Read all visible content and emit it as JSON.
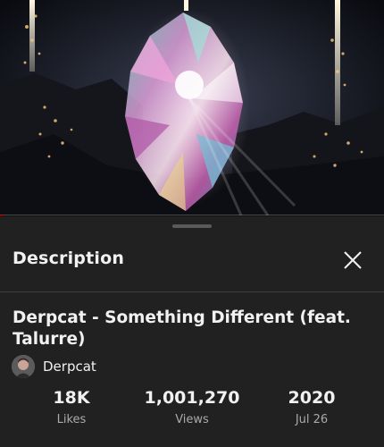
{
  "player": {
    "progress": 0.01,
    "accent_color": "#ff0000"
  },
  "description_panel": {
    "heading": "Description",
    "close_icon": "close-icon",
    "video_title": "Derpcat - Something Different (feat. Talurre)",
    "channel": {
      "name": "Derpcat",
      "avatar_icon": "channel-avatar"
    },
    "stats": [
      {
        "value": "18K",
        "label": "Likes"
      },
      {
        "value": "1,001,270",
        "label": "Views"
      },
      {
        "value": "2020",
        "label": "Jul 26"
      }
    ]
  }
}
